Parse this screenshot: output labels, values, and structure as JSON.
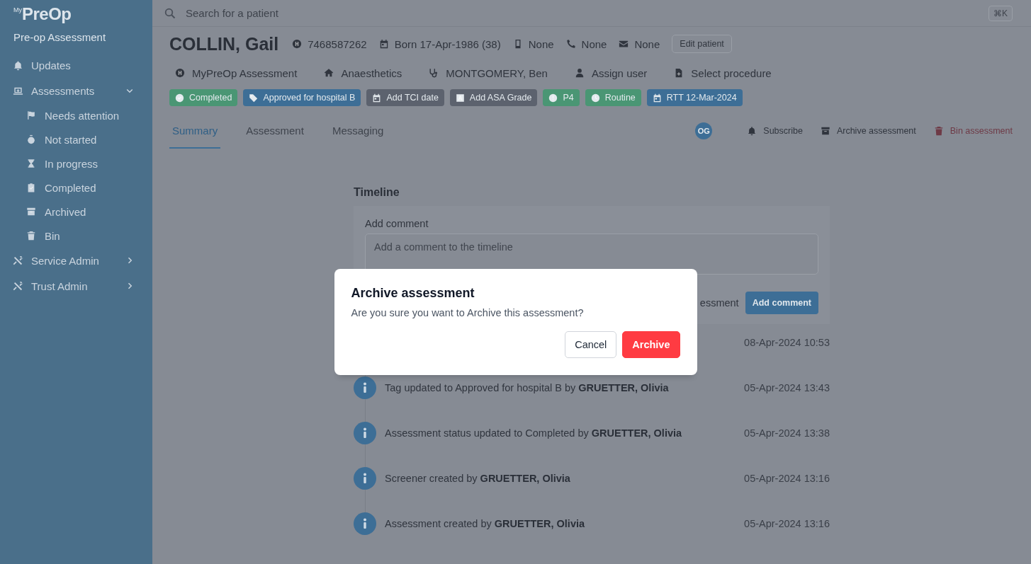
{
  "sidebar": {
    "logo": {
      "prefix": "My",
      "name": "PreOp"
    },
    "subtitle": "Pre-op Assessment",
    "items": [
      {
        "label": "Updates",
        "kind": "link"
      },
      {
        "label": "Assessments",
        "kind": "group",
        "expanded": true,
        "children": [
          {
            "label": "Needs attention"
          },
          {
            "label": "Not started"
          },
          {
            "label": "In progress"
          },
          {
            "label": "Completed"
          },
          {
            "label": "Archived"
          },
          {
            "label": "Bin"
          }
        ]
      },
      {
        "label": "Service Admin",
        "kind": "group",
        "expanded": false
      },
      {
        "label": "Trust Admin",
        "kind": "group",
        "expanded": false
      }
    ]
  },
  "search": {
    "placeholder": "Search for a patient",
    "shortcut": "⌘K"
  },
  "patient": {
    "name": "COLLIN, Gail",
    "info": [
      "7468587262",
      "Born 17-Apr-1986 (38)",
      "None",
      "None",
      "None"
    ],
    "edit_button": "Edit patient",
    "details": [
      "MyPreOp Assessment",
      "Anaesthetics",
      "MONTGOMERY, Ben",
      "Assign user",
      "Select procedure"
    ],
    "tags": [
      {
        "label": "Completed",
        "color": "#4a9674"
      },
      {
        "label": "Approved for hospital B",
        "color": "#3d6e96"
      },
      {
        "label": "Add TCI date",
        "color": "#5c626e"
      },
      {
        "label": "Add ASA Grade",
        "color": "#5c626e"
      },
      {
        "label": "P4",
        "color": "#4a9674"
      },
      {
        "label": "Routine",
        "color": "#4a9674"
      },
      {
        "label": "RTT 12-Mar-2024",
        "color": "#3d6e96"
      }
    ]
  },
  "tabs": [
    {
      "label": "Summary",
      "selected": true
    },
    {
      "label": "Assessment",
      "selected": false
    },
    {
      "label": "Messaging",
      "selected": false
    }
  ],
  "actions": {
    "avatar": "OG",
    "buttons": [
      {
        "label": "Subscribe",
        "kind": "normal"
      },
      {
        "label": "Archive assessment",
        "kind": "normal"
      },
      {
        "label": "Bin assessment",
        "kind": "danger"
      }
    ]
  },
  "timeline": {
    "title": "Timeline",
    "comment_label": "Add comment",
    "comment_placeholder": "Add a comment to the timeline",
    "footer_text": "essment",
    "comment_button": "Add comment",
    "entries": [
      {
        "time": "08-Apr-2024 10:53"
      },
      {
        "text": "Tag updated to Approved for hospital B by **GRUETTER, Olivia**",
        "time": "05-Apr-2024 13:43"
      },
      {
        "text": "Assessment status updated to Completed by **GRUETTER, Olivia**",
        "time": "05-Apr-2024 13:38"
      },
      {
        "text": "Screener created by **GRUETTER, Olivia**",
        "time": "05-Apr-2024 13:16"
      },
      {
        "text": "Assessment created by **GRUETTER, Olivia**",
        "time": "05-Apr-2024 13:16"
      }
    ]
  },
  "modal": {
    "title": "Archive assessment",
    "message": "Are you sure you want to Archive this assessment?",
    "buttons": [
      {
        "label": "Cancel",
        "kind": "secondary"
      },
      {
        "label": "Archive",
        "kind": "danger"
      }
    ]
  }
}
